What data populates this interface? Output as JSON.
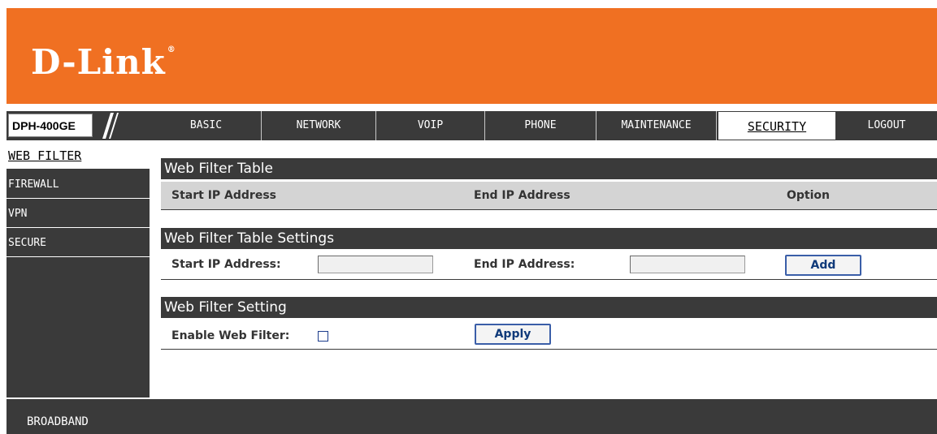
{
  "brand": {
    "logo_text": "D-Link",
    "logo_mark": "®",
    "color": "#f07022"
  },
  "model": {
    "label": "DPH-400GE"
  },
  "nav": {
    "tabs": [
      {
        "label": "BASIC"
      },
      {
        "label": "NETWORK"
      },
      {
        "label": "VOIP"
      },
      {
        "label": "PHONE"
      },
      {
        "label": "MAINTENANCE"
      },
      {
        "label": "SECURITY"
      },
      {
        "label": "LOGOUT"
      }
    ],
    "active": "SECURITY"
  },
  "sidebar": {
    "items": [
      {
        "label": "WEB FILTER"
      },
      {
        "label": "FIREWALL"
      },
      {
        "label": "VPN"
      },
      {
        "label": "SECURE"
      }
    ],
    "active": "WEB FILTER"
  },
  "table": {
    "title": "Web Filter Table",
    "columns": [
      "Start IP Address",
      "End IP Address",
      "Option"
    ],
    "rows": []
  },
  "table_settings": {
    "title": "Web Filter Table Settings",
    "start_label": "Start IP Address:",
    "start_value": "",
    "end_label": "End IP Address:",
    "end_value": "",
    "add_label": "Add"
  },
  "filter_setting": {
    "title": "Web Filter Setting",
    "enable_label": "Enable Web Filter:",
    "enabled": false,
    "apply_label": "Apply"
  },
  "footer": {
    "text": "BROADBAND"
  }
}
